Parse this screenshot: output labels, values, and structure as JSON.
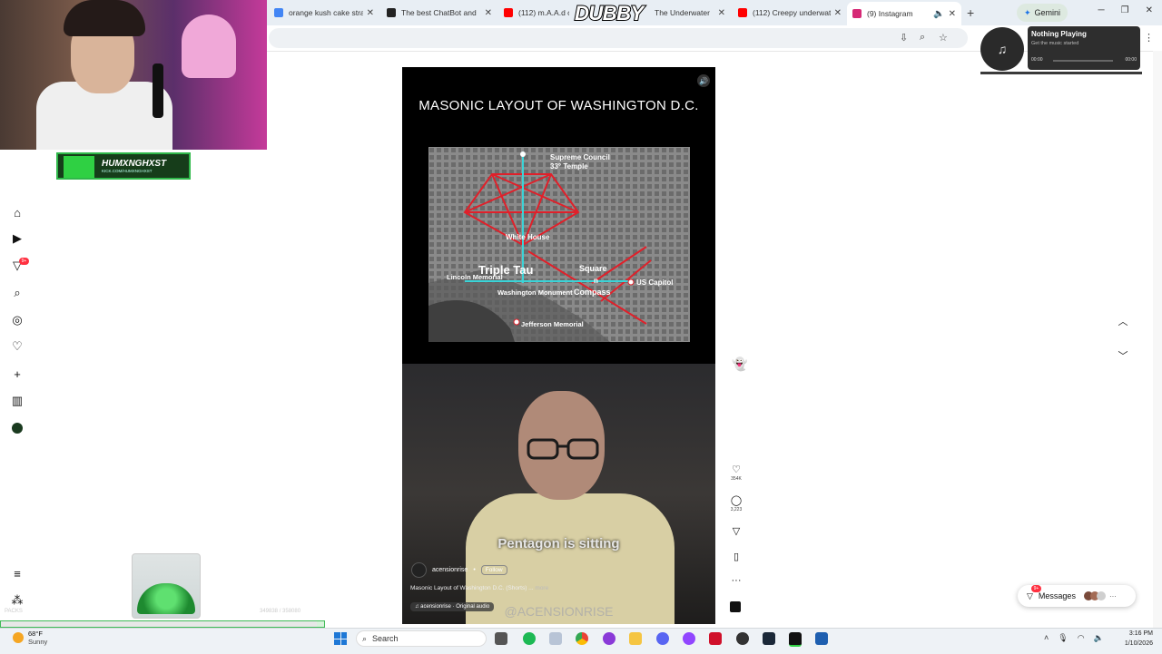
{
  "browser": {
    "tabs": [
      {
        "title": "orange kush cake stra",
        "icon": "google-favicon",
        "color": "#4285f4"
      },
      {
        "title": "The best ChatBot and",
        "icon": "chatbot-favicon",
        "color": "#222222"
      },
      {
        "title": "(112) m.A.A.d city",
        "icon": "youtube-favicon",
        "color": "#ff0000"
      },
      {
        "title": "The Underwater",
        "icon": "youtube-favicon",
        "color": "#ff0000"
      },
      {
        "title": "(112) Creepy underwat",
        "icon": "youtube-favicon",
        "color": "#ff0000"
      },
      {
        "title": "(9) Instagram",
        "icon": "instagram-favicon",
        "color": "#d62976",
        "active": true
      }
    ],
    "gemini_label": "Gemini"
  },
  "overlay": {
    "dubby": "DUBBY",
    "badge_name": "HUMXNGHXST",
    "badge_url": "KICK.COM/HUMXNGHXST",
    "progress_label": "PACKS",
    "progress_count": "349838 / 358080",
    "progress_fraction": 0.977
  },
  "nav": {
    "notifications_badge": "9+",
    "items": [
      "home-icon",
      "reels-icon",
      "notifications-icon",
      "search-icon",
      "explore-icon",
      "heart-icon",
      "create-icon",
      "dashboard-icon",
      "profile-icon"
    ]
  },
  "reel": {
    "title": "MASONIC LAYOUT OF WASHINGTON D.C.",
    "map_labels": {
      "supreme": "Supreme Council",
      "temple": "33° Temple",
      "white_house": "White House",
      "triple_tau": "Triple Tau",
      "lincoln": "Lincoln Memorial",
      "washington": "Washington Monument",
      "square": "Square",
      "n": "n",
      "compass": "Compass",
      "capitol": "US Capitol",
      "jefferson": "Jefferson Memorial"
    },
    "caption": "Pentagon is sitting",
    "username": "acensionrise",
    "follow_label": "Follow",
    "description": "Masonic Layout of Washington D.C. (Shorts) ...",
    "more_label": "more",
    "audio": "acensionrise · Original audio",
    "watermark": "@ACENSIONRISE"
  },
  "actions": {
    "likes": "354K",
    "comments": "3,223"
  },
  "music": {
    "title": "Nothing Playing",
    "subtitle": "Get the music started",
    "time_start": "00:00",
    "time_end": "00:00"
  },
  "messages": {
    "label": "Messages",
    "badge": "9+"
  },
  "taskbar": {
    "temp": "68°F",
    "condition": "Sunny",
    "search_placeholder": "Search",
    "time": "3:16 PM",
    "date": "1/10/2026"
  }
}
